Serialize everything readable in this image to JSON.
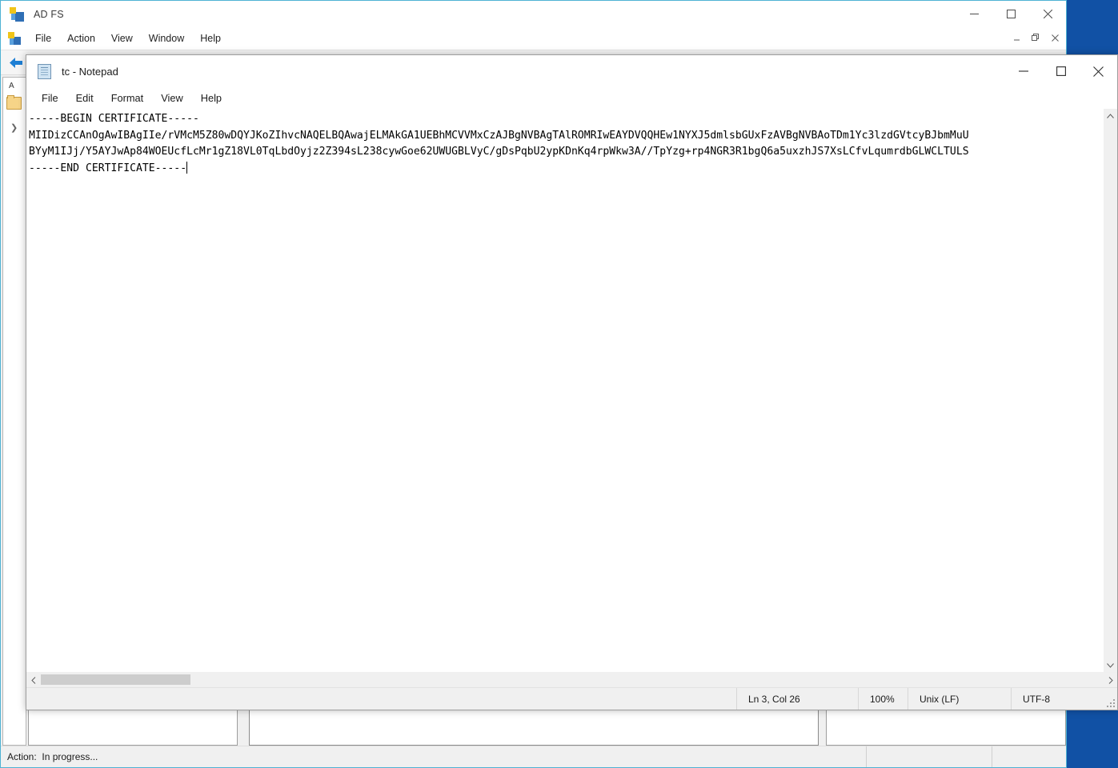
{
  "mmc": {
    "title": "AD FS",
    "title_icon": "adfs-icon",
    "menu": [
      "File",
      "Action",
      "View",
      "Window",
      "Help"
    ],
    "window_controls": {
      "minimize": "–",
      "maximize": "□",
      "close": "✕"
    },
    "mdi_controls": {
      "minimize": "_",
      "restore": "❐",
      "close": "✕"
    },
    "statusbar": {
      "action_label": "Action:  In progress..."
    }
  },
  "notepad": {
    "title": "tc - Notepad",
    "title_icon": "notepad-icon",
    "menu": [
      "File",
      "Edit",
      "Format",
      "View",
      "Help"
    ],
    "window_controls": {
      "minimize": "–",
      "maximize": "□",
      "close": "✕"
    },
    "content": {
      "line1": "-----BEGIN CERTIFICATE-----",
      "line2": "MIIDizCCAnOgAwIBAgIIe/rVMcM5Z80wDQYJKoZIhvcNAQELBQAwajELMAkGA1UEBhMCVVMxCzAJBgNVBAgTAlROMRIwEAYDVQQHEw1NYXJ5dmlsbGUxFzAVBgNVBAoTDm1Yc3lzdGVtcyBJbmMuU",
      "line3": "BYyM1IJj/Y5AYJwAp84WOEUcfLcMr1gZ18VL0TqLbdOyjz2Z394sL238cywGoe62UWUGBLVyC/gDsPqbU2ypKDnKq4rpWkw3A//TpYzg+rp4NGR3R1bgQ6a5uxzhJS7XsLCfvLqumrdbGLWCLTULS",
      "line4": "-----END CERTIFICATE-----"
    },
    "statusbar": {
      "position": "Ln 3, Col 26",
      "zoom": "100%",
      "line_ending": "Unix (LF)",
      "encoding": "UTF-8"
    },
    "scrollbars": {
      "v_up": "⌃",
      "v_down": "⌄",
      "h_left": "❮",
      "h_right": "❯"
    }
  },
  "colors": {
    "desktop_blue": "#1151a5",
    "window_border": "#4fb3d4",
    "chrome_bg": "#f0f0f0",
    "text": "#1a1a1a",
    "scroll_thumb": "#cdcdcd"
  }
}
